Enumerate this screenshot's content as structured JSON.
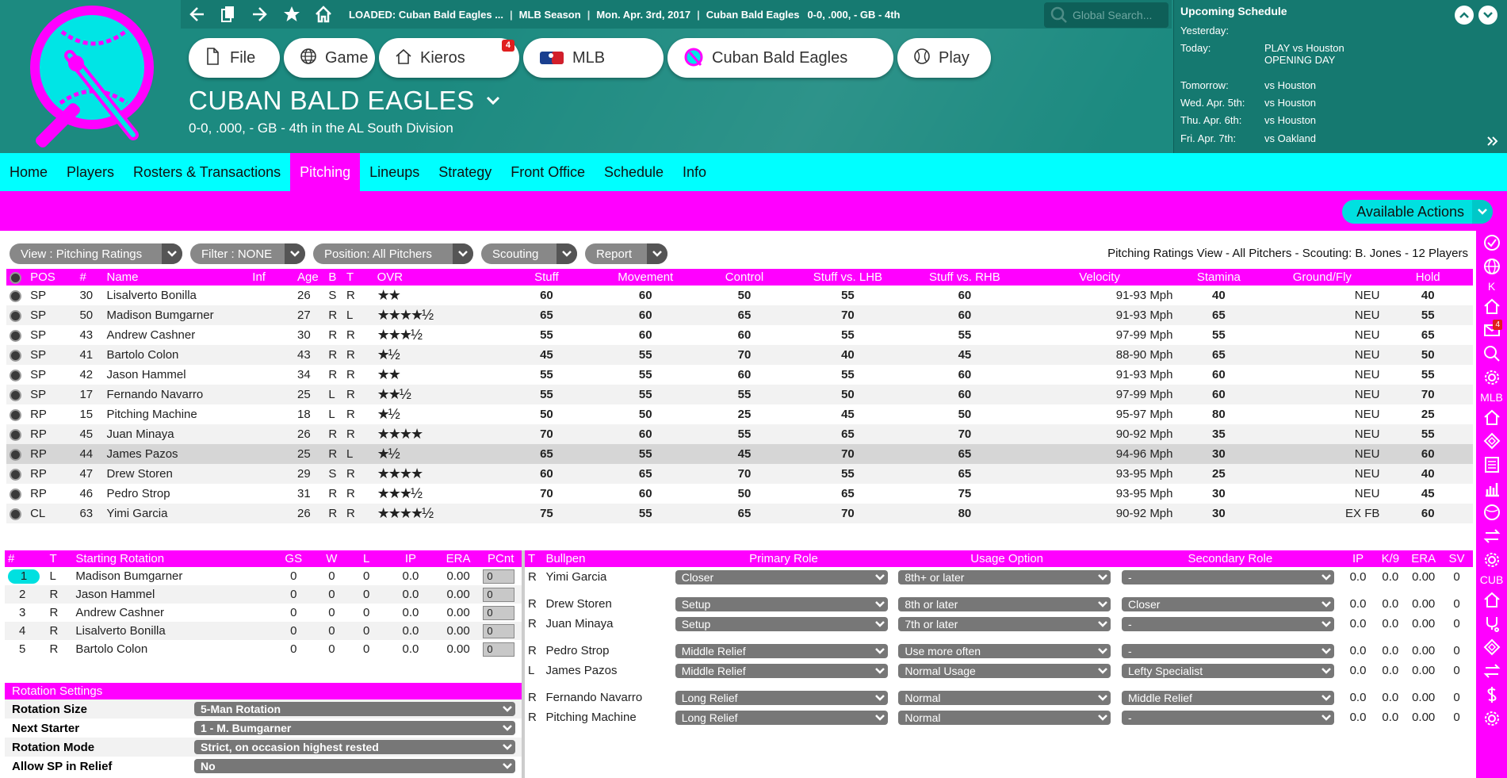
{
  "nav": {
    "loaded": "LOADED: Cuban Bald Eagles ...",
    "season": "MLB Season",
    "date": "Mon. Apr. 3rd, 2017",
    "team": "Cuban Bald Eagles",
    "record": "0-0, .000, - GB - 4th",
    "search_placeholder": "Global Search..."
  },
  "menu": [
    {
      "label": "File",
      "icon": "file-icon"
    },
    {
      "label": "Game",
      "icon": "globe-icon"
    },
    {
      "label": "Kieros",
      "icon": "home-icon",
      "badge": "4"
    },
    {
      "label": "MLB",
      "icon": "mlb-logo-icon"
    },
    {
      "label": "Cuban Bald Eagles",
      "icon": "team-logo-icon"
    },
    {
      "label": "Play",
      "icon": "baseball-icon"
    }
  ],
  "team": {
    "name": "CUBAN BALD EAGLES",
    "record": "0-0, .000, - GB - 4th in the AL South Division"
  },
  "schedule": {
    "title": "Upcoming Schedule",
    "rows": [
      {
        "day": "Yesterday:",
        "game": ""
      },
      {
        "day": "Today:",
        "game": "PLAY vs Houston",
        "note": "OPENING DAY"
      },
      {
        "day": "Tomorrow:",
        "game": "vs Houston"
      },
      {
        "day": "Wed. Apr. 5th:",
        "game": "vs Houston"
      },
      {
        "day": "Thu. Apr. 6th:",
        "game": "vs Houston"
      },
      {
        "day": "Fri. Apr. 7th:",
        "game": "vs Oakland"
      }
    ]
  },
  "tabs": [
    "Home",
    "Players",
    "Rosters & Transactions",
    "Pitching",
    "Lineups",
    "Strategy",
    "Front Office",
    "Schedule",
    "Info"
  ],
  "active_tab": "Pitching",
  "available_actions": "Available Actions",
  "filters": [
    {
      "label": "View : Pitching Ratings",
      "w": 218
    },
    {
      "label": "Filter : NONE",
      "w": 145
    },
    {
      "label": "Position: All Pitchers",
      "w": 202
    },
    {
      "label": "Scouting",
      "w": 121
    },
    {
      "label": "Report",
      "w": 104
    }
  ],
  "view_info": "Pitching Ratings View - All Pitchers - Scouting: B. Jones - 12 Players",
  "ratings_headers": [
    "POS",
    "#",
    "Name",
    "Inf",
    "Age",
    "B",
    "T",
    "OVR",
    "Stuff",
    "Movement",
    "Control",
    "Stuff vs. LHB",
    "Stuff vs. RHB",
    "Velocity",
    "Stamina",
    "Ground/Fly",
    "Hold"
  ],
  "pitchers": [
    {
      "pos": "SP",
      "num": "30",
      "name": "Lisalverto Bonilla",
      "age": "26",
      "b": "S",
      "t": "R",
      "stars": "★★",
      "stuff": "60",
      "mov": "60",
      "ctrl": "50",
      "lhb": "55",
      "rhb": "60",
      "velo": "91-93 Mph",
      "stam": "40",
      "gf": "NEU",
      "hold": "40"
    },
    {
      "pos": "SP",
      "num": "50",
      "name": "Madison Bumgarner",
      "age": "27",
      "b": "R",
      "t": "L",
      "stars": "★★★★½",
      "stuff": "65",
      "mov": "60",
      "ctrl": "65",
      "lhb": "70",
      "rhb": "60",
      "velo": "91-93 Mph",
      "stam": "65",
      "gf": "NEU",
      "hold": "55"
    },
    {
      "pos": "SP",
      "num": "43",
      "name": "Andrew Cashner",
      "age": "30",
      "b": "R",
      "t": "R",
      "stars": "★★★½",
      "stuff": "55",
      "mov": "60",
      "ctrl": "60",
      "lhb": "55",
      "rhb": "55",
      "velo": "97-99 Mph",
      "stam": "55",
      "gf": "NEU",
      "hold": "65"
    },
    {
      "pos": "SP",
      "num": "41",
      "name": "Bartolo Colon",
      "age": "43",
      "b": "R",
      "t": "R",
      "stars": "★½",
      "stuff": "45",
      "mov": "55",
      "ctrl": "70",
      "lhb": "40",
      "rhb": "45",
      "velo": "88-90 Mph",
      "stam": "65",
      "gf": "NEU",
      "hold": "50"
    },
    {
      "pos": "SP",
      "num": "42",
      "name": "Jason Hammel",
      "age": "34",
      "b": "R",
      "t": "R",
      "stars": "★★",
      "stuff": "55",
      "mov": "55",
      "ctrl": "60",
      "lhb": "55",
      "rhb": "60",
      "velo": "91-93 Mph",
      "stam": "60",
      "gf": "NEU",
      "hold": "55"
    },
    {
      "pos": "SP",
      "num": "17",
      "name": "Fernando Navarro",
      "age": "25",
      "b": "L",
      "t": "R",
      "stars": "★★½",
      "stuff": "55",
      "mov": "55",
      "ctrl": "55",
      "lhb": "50",
      "rhb": "60",
      "velo": "97-99 Mph",
      "stam": "60",
      "gf": "NEU",
      "hold": "70"
    },
    {
      "pos": "RP",
      "num": "15",
      "name": "Pitching Machine",
      "age": "18",
      "b": "L",
      "t": "R",
      "stars": "★½",
      "stuff": "50",
      "mov": "50",
      "ctrl": "25",
      "lhb": "45",
      "rhb": "50",
      "velo": "95-97 Mph",
      "stam": "80",
      "gf": "NEU",
      "hold": "25"
    },
    {
      "pos": "RP",
      "num": "45",
      "name": "Juan Minaya",
      "age": "26",
      "b": "R",
      "t": "R",
      "stars": "★★★★",
      "stuff": "70",
      "mov": "60",
      "ctrl": "55",
      "lhb": "65",
      "rhb": "70",
      "velo": "90-92 Mph",
      "stam": "35",
      "gf": "NEU",
      "hold": "55"
    },
    {
      "pos": "RP",
      "num": "44",
      "name": "James Pazos",
      "age": "25",
      "b": "R",
      "t": "L",
      "stars": "★½",
      "stuff": "65",
      "mov": "55",
      "ctrl": "45",
      "lhb": "70",
      "rhb": "65",
      "velo": "94-96 Mph",
      "stam": "30",
      "gf": "NEU",
      "hold": "60"
    },
    {
      "pos": "RP",
      "num": "47",
      "name": "Drew Storen",
      "age": "29",
      "b": "S",
      "t": "R",
      "stars": "★★★★",
      "stuff": "60",
      "mov": "65",
      "ctrl": "70",
      "lhb": "55",
      "rhb": "65",
      "velo": "93-95 Mph",
      "stam": "25",
      "gf": "NEU",
      "hold": "40"
    },
    {
      "pos": "RP",
      "num": "46",
      "name": "Pedro Strop",
      "age": "31",
      "b": "R",
      "t": "R",
      "stars": "★★★½",
      "stuff": "70",
      "mov": "60",
      "ctrl": "50",
      "lhb": "65",
      "rhb": "75",
      "velo": "93-95 Mph",
      "stam": "30",
      "gf": "NEU",
      "hold": "45"
    },
    {
      "pos": "CL",
      "num": "63",
      "name": "Yimi Garcia",
      "age": "26",
      "b": "R",
      "t": "R",
      "stars": "★★★★½",
      "stuff": "75",
      "mov": "55",
      "ctrl": "65",
      "lhb": "70",
      "rhb": "80",
      "velo": "90-92 Mph",
      "stam": "30",
      "gf": "EX FB",
      "hold": "60"
    }
  ],
  "rotation_headers": [
    "#",
    "T",
    "Starting Rotation",
    "GS",
    "W",
    "L",
    "IP",
    "ERA",
    "PCnt"
  ],
  "rotation": [
    {
      "n": "1",
      "t": "L",
      "name": "Madison Bumgarner",
      "gs": "0",
      "w": "0",
      "l": "0",
      "ip": "0.0",
      "era": "0.00",
      "pc": "0"
    },
    {
      "n": "2",
      "t": "R",
      "name": "Jason Hammel",
      "gs": "0",
      "w": "0",
      "l": "0",
      "ip": "0.0",
      "era": "0.00",
      "pc": "0"
    },
    {
      "n": "3",
      "t": "R",
      "name": "Andrew Cashner",
      "gs": "0",
      "w": "0",
      "l": "0",
      "ip": "0.0",
      "era": "0.00",
      "pc": "0"
    },
    {
      "n": "4",
      "t": "R",
      "name": "Lisalverto Bonilla",
      "gs": "0",
      "w": "0",
      "l": "0",
      "ip": "0.0",
      "era": "0.00",
      "pc": "0"
    },
    {
      "n": "5",
      "t": "R",
      "name": "Bartolo Colon",
      "gs": "0",
      "w": "0",
      "l": "0",
      "ip": "0.0",
      "era": "0.00",
      "pc": "0"
    }
  ],
  "rotation_settings": {
    "title": "Rotation Settings",
    "rows": [
      {
        "label": "Rotation Size",
        "value": "5-Man Rotation"
      },
      {
        "label": "Next Starter",
        "value": "1 - M. Bumgarner"
      },
      {
        "label": "Rotation Mode",
        "value": "Strict, on occasion highest rested"
      },
      {
        "label": "Allow SP in Relief",
        "value": "No"
      }
    ]
  },
  "bullpen_headers": [
    "T",
    "Bullpen",
    "Primary Role",
    "Usage Option",
    "Secondary Role",
    "IP",
    "K/9",
    "ERA",
    "SV"
  ],
  "bullpen": [
    {
      "t": "R",
      "name": "Yimi Garcia",
      "role": "Closer",
      "usage": "8th+ or later",
      "sec": "-",
      "ip": "0.0",
      "k9": "0.0",
      "era": "0.00",
      "sv": "0",
      "gap": false
    },
    {
      "t": "R",
      "name": "Drew Storen",
      "role": "Setup",
      "usage": "8th or later",
      "sec": "Closer",
      "ip": "0.0",
      "k9": "0.0",
      "era": "0.00",
      "sv": "0",
      "gap": true
    },
    {
      "t": "R",
      "name": "Juan Minaya",
      "role": "Setup",
      "usage": "7th or later",
      "sec": "-",
      "ip": "0.0",
      "k9": "0.0",
      "era": "0.00",
      "sv": "0",
      "gap": false
    },
    {
      "t": "R",
      "name": "Pedro Strop",
      "role": "Middle Relief",
      "usage": "Use more often",
      "sec": "-",
      "ip": "0.0",
      "k9": "0.0",
      "era": "0.00",
      "sv": "0",
      "gap": true
    },
    {
      "t": "L",
      "name": "James Pazos",
      "role": "Middle Relief",
      "usage": "Normal Usage",
      "sec": "Lefty Specialist",
      "ip": "0.0",
      "k9": "0.0",
      "era": "0.00",
      "sv": "0",
      "gap": false
    },
    {
      "t": "R",
      "name": "Fernando Navarro",
      "role": "Long Relief",
      "usage": "Normal",
      "sec": "Middle Relief",
      "ip": "0.0",
      "k9": "0.0",
      "era": "0.00",
      "sv": "0",
      "gap": true
    },
    {
      "t": "R",
      "name": "Pitching Machine",
      "role": "Long Relief",
      "usage": "Normal",
      "sec": "-",
      "ip": "0.0",
      "k9": "0.0",
      "era": "0.00",
      "sv": "0",
      "gap": false
    }
  ],
  "right_sidebar": [
    {
      "icon": "check-icon"
    },
    {
      "icon": "globe-icon"
    },
    {
      "label": "K"
    },
    {
      "icon": "home-icon"
    },
    {
      "icon": "mail-icon",
      "badge": "4"
    },
    {
      "icon": "search-icon"
    },
    {
      "icon": "gear-icon"
    },
    {
      "label": "MLB"
    },
    {
      "icon": "home-icon"
    },
    {
      "icon": "diamond-icon"
    },
    {
      "icon": "list-icon"
    },
    {
      "icon": "bar-chart-icon"
    },
    {
      "icon": "baseball-icon"
    },
    {
      "icon": "swap-icon"
    },
    {
      "icon": "gear-icon"
    },
    {
      "label": "CUB"
    },
    {
      "icon": "home-icon"
    },
    {
      "icon": "medical-icon"
    },
    {
      "icon": "diamond-icon"
    },
    {
      "icon": "swap-icon"
    },
    {
      "icon": "dollar-icon"
    },
    {
      "icon": "gear-icon"
    }
  ]
}
